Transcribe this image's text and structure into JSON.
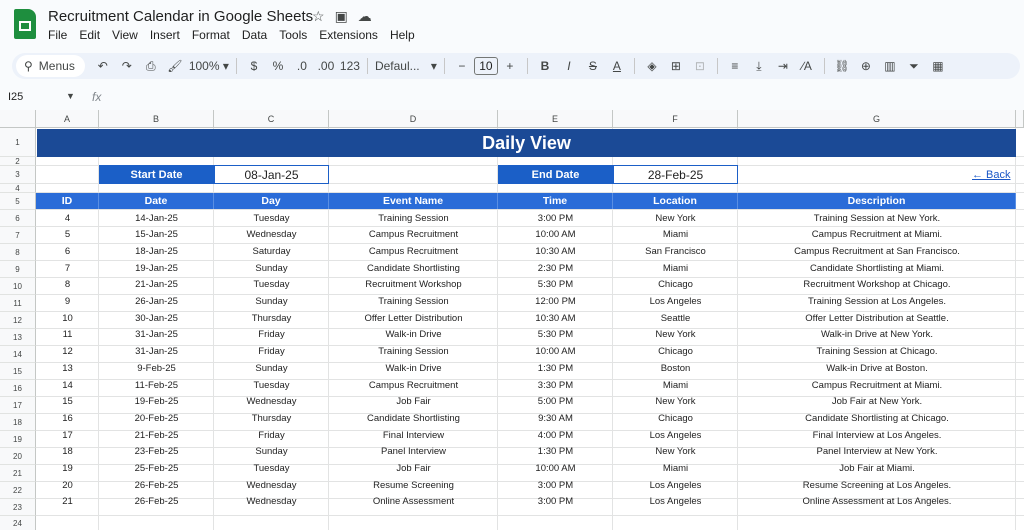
{
  "app": {
    "doc_title": "Recruitment Calendar in Google Sheets",
    "menu": [
      "File",
      "Edit",
      "View",
      "Insert",
      "Format",
      "Data",
      "Tools",
      "Extensions",
      "Help"
    ]
  },
  "toolbar": {
    "menus_label": "Menus",
    "zoom": "100%",
    "currency": "$",
    "percent": "%",
    "dec_decrease": ".0",
    "dec_increase": ".00",
    "number_format": "123",
    "font": "Defaul...",
    "font_size": "10",
    "minus": "−",
    "plus": "+",
    "bold": "B"
  },
  "formula_bar": {
    "name_box": "I25",
    "fx": "fx",
    "value": ""
  },
  "grid": {
    "columns": [
      "A",
      "B",
      "C",
      "D",
      "E",
      "F",
      "G"
    ],
    "rows": [
      "1",
      "2",
      "3",
      "4",
      "5",
      "6",
      "7",
      "8",
      "9",
      "10",
      "11",
      "12",
      "13",
      "14",
      "15",
      "16",
      "17",
      "18",
      "19",
      "20",
      "21",
      "22",
      "23",
      "24"
    ]
  },
  "sheet": {
    "banner": "Daily View",
    "start_label": "Start Date",
    "start_value": "08-Jan-25",
    "end_label": "End Date",
    "end_value": "28-Feb-25",
    "back_link": "← Back",
    "headers": [
      "ID",
      "Date",
      "Day",
      "Event Name",
      "Time",
      "Location",
      "Description"
    ],
    "rows": [
      [
        "4",
        "14-Jan-25",
        "Tuesday",
        "Training Session",
        "3:00 PM",
        "New York",
        "Training Session at New York."
      ],
      [
        "5",
        "15-Jan-25",
        "Wednesday",
        "Campus Recruitment",
        "10:00 AM",
        "Miami",
        "Campus Recruitment at Miami."
      ],
      [
        "6",
        "18-Jan-25",
        "Saturday",
        "Campus Recruitment",
        "10:30 AM",
        "San Francisco",
        "Campus Recruitment at San Francisco."
      ],
      [
        "7",
        "19-Jan-25",
        "Sunday",
        "Candidate Shortlisting",
        "2:30 PM",
        "Miami",
        "Candidate Shortlisting at Miami."
      ],
      [
        "8",
        "21-Jan-25",
        "Tuesday",
        "Recruitment Workshop",
        "5:30 PM",
        "Chicago",
        "Recruitment Workshop at Chicago."
      ],
      [
        "9",
        "26-Jan-25",
        "Sunday",
        "Training Session",
        "12:00 PM",
        "Los Angeles",
        "Training Session at Los Angeles."
      ],
      [
        "10",
        "30-Jan-25",
        "Thursday",
        "Offer Letter Distribution",
        "10:30 AM",
        "Seattle",
        "Offer Letter Distribution at Seattle."
      ],
      [
        "11",
        "31-Jan-25",
        "Friday",
        "Walk-in Drive",
        "5:30 PM",
        "New York",
        "Walk-in Drive at New York."
      ],
      [
        "12",
        "31-Jan-25",
        "Friday",
        "Training Session",
        "10:00 AM",
        "Chicago",
        "Training Session at Chicago."
      ],
      [
        "13",
        "9-Feb-25",
        "Sunday",
        "Walk-in Drive",
        "1:30 PM",
        "Boston",
        "Walk-in Drive at Boston."
      ],
      [
        "14",
        "11-Feb-25",
        "Tuesday",
        "Campus Recruitment",
        "3:30 PM",
        "Miami",
        "Campus Recruitment at Miami."
      ],
      [
        "15",
        "19-Feb-25",
        "Wednesday",
        "Job Fair",
        "5:00 PM",
        "New York",
        "Job Fair at New York."
      ],
      [
        "16",
        "20-Feb-25",
        "Thursday",
        "Candidate Shortlisting",
        "9:30 AM",
        "Chicago",
        "Candidate Shortlisting at Chicago."
      ],
      [
        "17",
        "21-Feb-25",
        "Friday",
        "Final Interview",
        "4:00 PM",
        "Los Angeles",
        "Final Interview at Los Angeles."
      ],
      [
        "18",
        "23-Feb-25",
        "Sunday",
        "Panel Interview",
        "1:30 PM",
        "New York",
        "Panel Interview at New York."
      ],
      [
        "19",
        "25-Feb-25",
        "Tuesday",
        "Job Fair",
        "10:00 AM",
        "Miami",
        "Job Fair at Miami."
      ],
      [
        "20",
        "26-Feb-25",
        "Wednesday",
        "Resume Screening",
        "3:00 PM",
        "Los Angeles",
        "Resume Screening at Los Angeles."
      ],
      [
        "21",
        "26-Feb-25",
        "Wednesday",
        "Online Assessment",
        "3:00 PM",
        "Los Angeles",
        "Online Assessment at Los Angeles."
      ]
    ]
  },
  "colors": {
    "banner": "#1b4a96",
    "label_fill": "#1b5fc7",
    "header_fill": "#2a6cd8",
    "link": "#1a57c7"
  }
}
